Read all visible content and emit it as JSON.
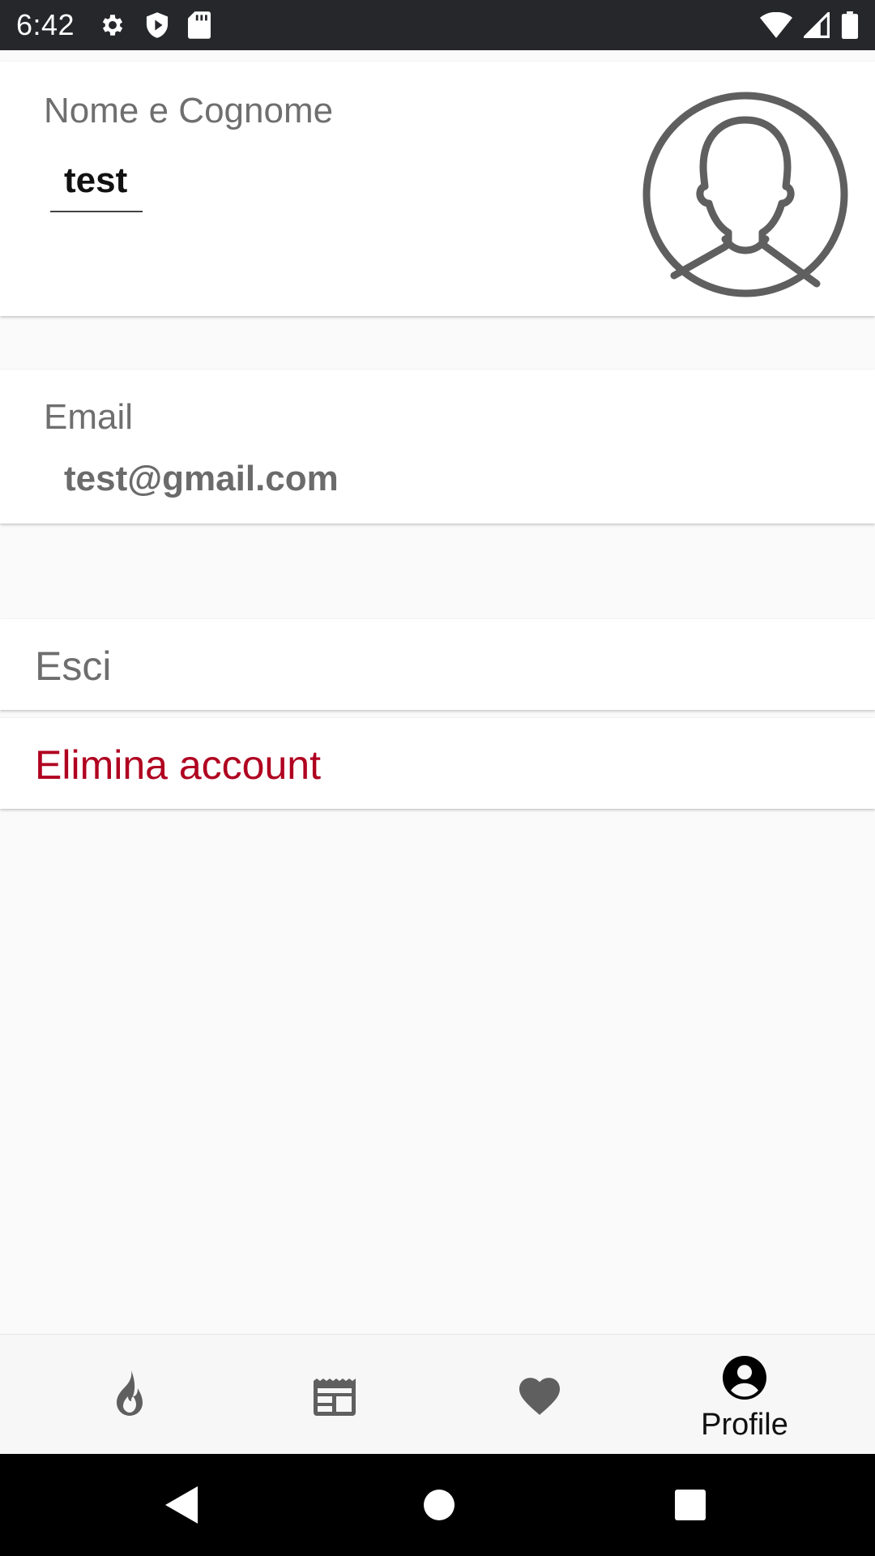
{
  "status_bar": {
    "time": "6:42",
    "left_icons": [
      "gear-icon",
      "shield-icon",
      "sd-card-icon"
    ],
    "right_icons": [
      "wifi-icon",
      "signal-icon",
      "battery-icon"
    ]
  },
  "profile": {
    "name_label": "Nome e Cognome",
    "name_value": "test",
    "email_label": "Email",
    "email_value": "test@gmail.com",
    "avatar_icon": "user-avatar-icon"
  },
  "actions": {
    "logout_label": "Esci",
    "delete_account_label": "Elimina account"
  },
  "bottom_nav": {
    "items": [
      {
        "icon": "fire-icon",
        "label": ""
      },
      {
        "icon": "newspaper-icon",
        "label": ""
      },
      {
        "icon": "heart-icon",
        "label": ""
      },
      {
        "icon": "account-circle-icon",
        "label": "Profile",
        "active": true
      }
    ]
  },
  "system_nav": {
    "icons": [
      "back-icon",
      "home-icon",
      "recents-icon"
    ]
  },
  "colors": {
    "status_bar_bg": "#26272b",
    "danger": "#b00020",
    "background": "#fafafa",
    "icon_gray": "#5f5f5f"
  }
}
